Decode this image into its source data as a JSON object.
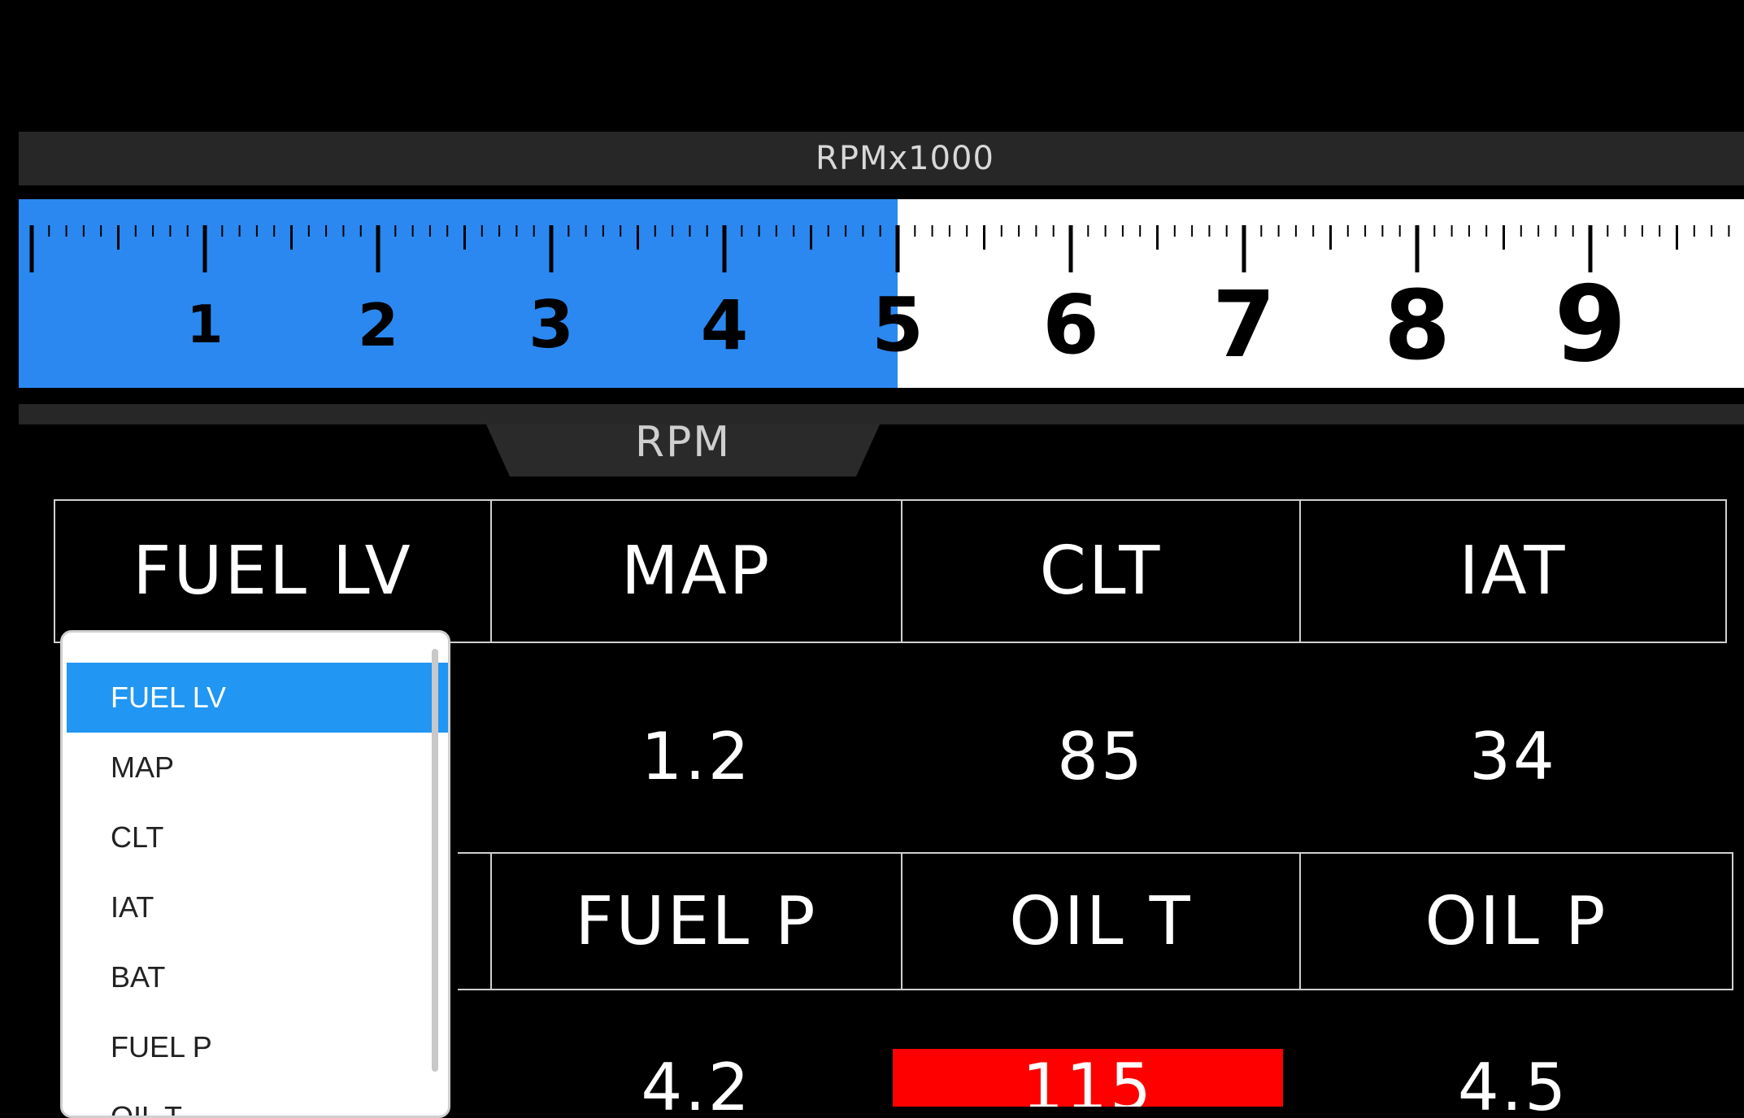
{
  "gauge": {
    "label": "RPMx1000",
    "caption": "RPM",
    "value_thousands": 5.0,
    "max_thousands": 10.0,
    "numbers": [
      "1",
      "2",
      "3",
      "4",
      "5",
      "6",
      "7",
      "8",
      "9"
    ],
    "colors": {
      "fill": "#2b88f0",
      "tape": "#ffffff",
      "bar": "#272727"
    }
  },
  "grid": {
    "row1": {
      "headers": [
        "FUEL LV",
        "MAP",
        "CLT",
        "IAT"
      ],
      "values": [
        "",
        "1.2",
        "85",
        "34"
      ]
    },
    "row2": {
      "headers": [
        "",
        "FUEL P",
        "OIL T",
        "OIL P"
      ],
      "values": [
        "",
        "4.2",
        "115",
        "4.5"
      ]
    },
    "alert_color": "#ff0000"
  },
  "dropdown": {
    "selected": "FUEL LV",
    "options": [
      "FUEL LV",
      "MAP",
      "CLT",
      "IAT",
      "BAT",
      "FUEL P",
      "OIL T"
    ],
    "accent_color": "#2196f3"
  }
}
